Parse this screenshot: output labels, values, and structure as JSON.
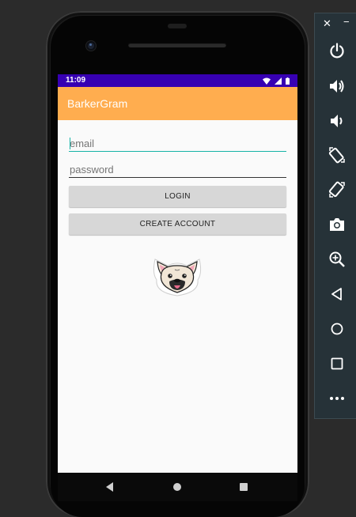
{
  "status_bar": {
    "time": "11:09",
    "background_color": "#3700b3",
    "icons": [
      "wifi-icon",
      "signal-icon",
      "battery-icon"
    ]
  },
  "app_bar": {
    "title": "BarkerGram",
    "background_color": "#ffad4f"
  },
  "login_form": {
    "email_placeholder": "email",
    "password_placeholder": "password",
    "login_label": "LOGIN",
    "create_account_label": "CREATE ACCOUNT",
    "accent_color": "#16b3a6"
  },
  "logo": {
    "icon": "french-bulldog-logo"
  },
  "nav_bar": {
    "icons": [
      "back-icon",
      "home-icon",
      "recents-icon"
    ]
  },
  "emulator_panel": {
    "close_label": "✕",
    "minimize_label": "−",
    "controls": [
      "power-icon",
      "volume-up-icon",
      "volume-down-icon",
      "rotate-left-icon",
      "rotate-right-icon",
      "camera-icon",
      "zoom-icon",
      "back-icon",
      "home-icon",
      "overview-icon",
      "more-icon"
    ]
  }
}
